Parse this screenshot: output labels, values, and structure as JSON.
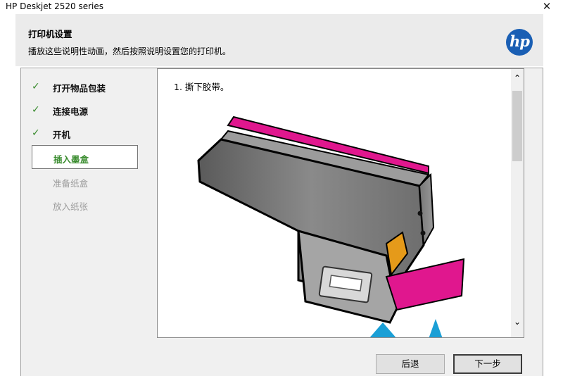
{
  "window": {
    "title": "HP Deskjet 2520 series",
    "close_symbol": "✕"
  },
  "header": {
    "title": "打印机设置",
    "subtitle": "播放这些说明性动画，然后按照说明设置您的打印机。",
    "logo_text": "hp"
  },
  "steps": [
    {
      "label": "打开物品包装",
      "status": "done"
    },
    {
      "label": "连接电源",
      "status": "done"
    },
    {
      "label": "开机",
      "status": "done"
    },
    {
      "label": "插入墨盒",
      "status": "active"
    },
    {
      "label": "准备纸盒",
      "status": "pending"
    },
    {
      "label": "放入纸张",
      "status": "pending"
    }
  ],
  "check_symbol": "✓",
  "content": {
    "instruction": "1.   撕下胶带。"
  },
  "scrollbar": {
    "up_symbol": "⌃",
    "down_symbol": "⌄"
  },
  "buttons": {
    "back": "后退",
    "next": "下一步"
  },
  "colors": {
    "accent_green": "#3a8c2f",
    "tape_magenta": "#e0178e",
    "hp_blue": "#1a5fb4"
  }
}
